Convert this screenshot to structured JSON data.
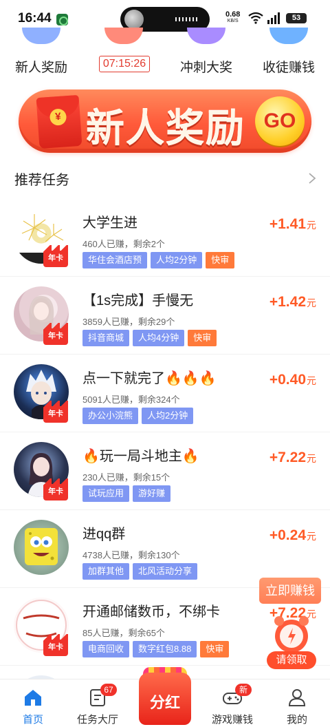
{
  "status_bar": {
    "time": "16:44",
    "net_speed": "0.68",
    "net_unit": "KB/S",
    "battery": "53"
  },
  "categories": [
    {
      "label": "新人奖励",
      "color": "#8fb0ff"
    },
    {
      "label": "07:15:26",
      "color": "#ff8a7a"
    },
    {
      "label": "冲刺大奖",
      "color": "#a98cff"
    },
    {
      "label": "收徒赚钱",
      "color": "#6fb2ff"
    }
  ],
  "banner": {
    "coin": "¥",
    "text": "新人奖励",
    "go": "GO"
  },
  "section": {
    "title": "推荐任务"
  },
  "crown_label": "年卡",
  "reward_unit": "元",
  "tasks": [
    {
      "title": "大学生进",
      "meta": "460人已赚，剩余2个",
      "reward": "+1.41",
      "tags": [
        "华住会酒店预",
        "人均2分钟",
        "快审"
      ]
    },
    {
      "title": "【1s完成】手慢无",
      "meta": "3859人已赚，剩余29个",
      "reward": "+1.42",
      "tags": [
        "抖音商城",
        "人均4分钟",
        "快审"
      ]
    },
    {
      "title": "点一下就完了🔥🔥🔥",
      "meta": "5091人已赚，剩余324个",
      "reward": "+0.40",
      "tags": [
        "办公小浣熊",
        "人均2分钟"
      ]
    },
    {
      "title": "🔥玩一局斗地主🔥",
      "meta": "230人已赚，剩余15个",
      "reward": "+7.22",
      "tags": [
        "试玩应用",
        "游好赚"
      ]
    },
    {
      "title": "进qq群",
      "meta": "4738人已赚，剩余130个",
      "reward": "+0.24",
      "tags": [
        "加群其他",
        "北风活动分享"
      ]
    },
    {
      "title": "开通邮储数币，不绑卡",
      "meta": "85人已赚，剩余65个",
      "reward": "+7.22",
      "tags": [
        "电商回收",
        "数字红包8.88",
        "快审"
      ]
    }
  ],
  "floating": {
    "earn_now": "立即赚钱",
    "claim": "请领取"
  },
  "bottom_nav": {
    "home": "首页",
    "task_hall": "任务大厅",
    "task_hall_badge": "67",
    "center": "分红",
    "game_earn": "游戏赚钱",
    "game_badge": "新",
    "mine": "我的"
  },
  "colors": {
    "accent_blue": "#1e7be6",
    "tag_blue": "#7f97f3",
    "tag_orange": "#ff7a3a",
    "reward": "#ff5a26"
  }
}
